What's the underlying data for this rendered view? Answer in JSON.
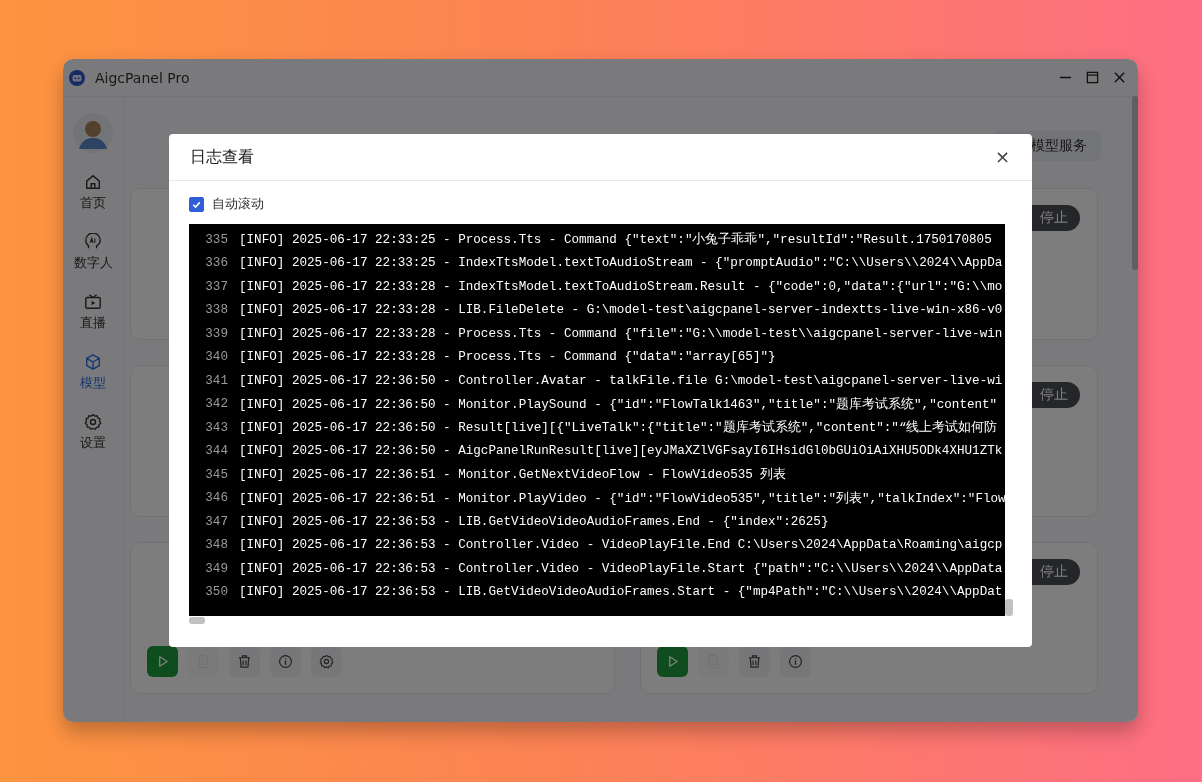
{
  "window": {
    "title": "AigcPanel Pro"
  },
  "sidebar": {
    "items": [
      {
        "label": "首页",
        "kind": "home",
        "selected": false
      },
      {
        "label": "数字人",
        "kind": "ai",
        "selected": false
      },
      {
        "label": "直播",
        "kind": "tv",
        "selected": false
      },
      {
        "label": "模型",
        "kind": "cube",
        "selected": true
      },
      {
        "label": "设置",
        "kind": "gear",
        "selected": false
      }
    ]
  },
  "header_button": "模型服务",
  "card_rows": [
    {
      "status": "停止"
    },
    {
      "status": "停止"
    },
    {
      "status": "停止",
      "left_actions": [
        {
          "kind": "play",
          "disabled": false
        },
        {
          "kind": "file",
          "disabled": true
        },
        {
          "kind": "delete",
          "disabled": false
        },
        {
          "kind": "info",
          "disabled": false
        },
        {
          "kind": "settings",
          "disabled": false
        }
      ],
      "right_actions": [
        {
          "kind": "play",
          "disabled": false
        },
        {
          "kind": "file",
          "disabled": true
        },
        {
          "kind": "delete",
          "disabled": false
        },
        {
          "kind": "info",
          "disabled": false
        }
      ]
    }
  ],
  "dialog": {
    "title": "日志查看",
    "close": "×",
    "auto_scroll": {
      "label": "自动滚动",
      "checked": true
    },
    "log_lines": [
      {
        "number": "335",
        "text": "[INFO] 2025-06-17 22:33:25 - Process.Tts - Command {\"text\":\"小兔子乖乖\",\"resultId\":\"Result.1750170805"
      },
      {
        "number": "336",
        "text": "[INFO] 2025-06-17 22:33:25 - IndexTtsModel.textToAudioStream - {\"promptAudio\":\"C:\\\\Users\\\\2024\\\\AppDa"
      },
      {
        "number": "337",
        "text": "[INFO] 2025-06-17 22:33:28 - IndexTtsModel.textToAudioStream.Result - {\"code\":0,\"data\":{\"url\":\"G:\\\\mo"
      },
      {
        "number": "338",
        "text": "[INFO] 2025-06-17 22:33:28 - LIB.FileDelete - G:\\model-test\\aigcpanel-server-indextts-live-win-x86-v0"
      },
      {
        "number": "339",
        "text": "[INFO] 2025-06-17 22:33:28 - Process.Tts - Command {\"file\":\"G:\\\\model-test\\\\aigcpanel-server-live-win"
      },
      {
        "number": "340",
        "text": "[INFO] 2025-06-17 22:33:28 - Process.Tts - Command {\"data\":\"array[65]\"}"
      },
      {
        "number": "341",
        "text": "[INFO] 2025-06-17 22:36:50 - Controller.Avatar - talkFile.file G:\\model-test\\aigcpanel-server-live-wi"
      },
      {
        "number": "342",
        "text": "[INFO] 2025-06-17 22:36:50 - Monitor.PlaySound - {\"id\":\"FlowTalk1463\",\"title\":\"题库考试系统\",\"content\""
      },
      {
        "number": "343",
        "text": "[INFO] 2025-06-17 22:36:50 - Result[live][{\"LiveTalk\":{\"title\":\"题库考试系统\",\"content\":\"“线上考试如何防"
      },
      {
        "number": "344",
        "text": "[INFO] 2025-06-17 22:36:50 - AigcPanelRunResult[live][eyJMaXZlVGFsayI6IHsidGl0bGUiOiAiXHU5ODk4XHU1ZTk"
      },
      {
        "number": "345",
        "text": "[INFO] 2025-06-17 22:36:51 - Monitor.GetNextVideoFlow - FlowVideo535 列表"
      },
      {
        "number": "346",
        "text": "[INFO] 2025-06-17 22:36:51 - Monitor.PlayVideo - {\"id\":\"FlowVideo535\",\"title\":\"列表\",\"talkIndex\":\"Flow"
      },
      {
        "number": "347",
        "text": "[INFO] 2025-06-17 22:36:53 - LIB.GetVideoVideoAudioFrames.End - {\"index\":2625}"
      },
      {
        "number": "348",
        "text": "[INFO] 2025-06-17 22:36:53 - Controller.Video - VideoPlayFile.End C:\\Users\\2024\\AppData\\Roaming\\aigcp"
      },
      {
        "number": "349",
        "text": "[INFO] 2025-06-17 22:36:53 - Controller.Video - VideoPlayFile.Start {\"path\":\"C:\\\\Users\\\\2024\\\\AppData"
      },
      {
        "number": "350",
        "text": "[INFO] 2025-06-17 22:36:53 - LIB.GetVideoVideoAudioFrames.Start - {\"mp4Path\":\"C:\\\\Users\\\\2024\\\\AppDat"
      }
    ]
  }
}
